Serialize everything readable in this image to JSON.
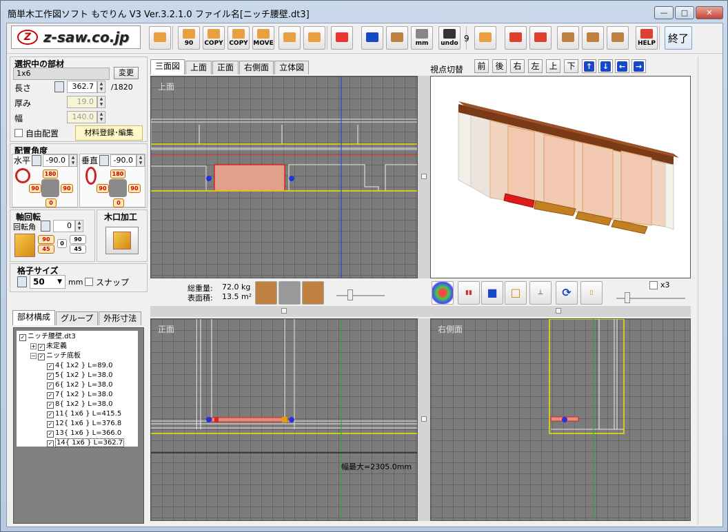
{
  "window": {
    "title": "簡単木工作図ソフト もでりん V3   Ver.3.2.1.0  ファイル名[ニッチ腰壁.dt3]",
    "min": "—",
    "max": "□",
    "close": "✕"
  },
  "toolbar": {
    "logo_text": "z-saw.co.jp",
    "buttons": [
      {
        "name": "add-part",
        "label": ""
      },
      {
        "name": "rotate90",
        "label": "90"
      },
      {
        "name": "copy",
        "label": "COPY"
      },
      {
        "name": "copy-multi",
        "label": "COPY"
      },
      {
        "name": "move",
        "label": "MOVE"
      },
      {
        "name": "mirror",
        "label": ""
      },
      {
        "name": "align",
        "label": ""
      },
      {
        "name": "delete",
        "label": ""
      },
      {
        "name": "frame",
        "label": ""
      },
      {
        "name": "grid-panel",
        "label": ""
      },
      {
        "name": "measure",
        "label": "mm"
      },
      {
        "name": "undo",
        "label": "undo"
      },
      {
        "name": "redo",
        "label": ""
      },
      {
        "name": "import",
        "label": ""
      },
      {
        "name": "export",
        "label": ""
      },
      {
        "name": "page-setup",
        "label": ""
      },
      {
        "name": "house",
        "label": ""
      },
      {
        "name": "table",
        "label": ""
      },
      {
        "name": "help",
        "label": "HELP"
      }
    ],
    "undo_count": "9",
    "exit_label": "終了"
  },
  "selected_part": {
    "title": "選択中の部材",
    "name": "1x6",
    "change_label": "変更",
    "length_label": "長さ",
    "length": "362.7",
    "length_max": "/1820",
    "thickness_label": "厚み",
    "thickness": "19.0",
    "width_label": "幅",
    "width": "140.0",
    "free_place_label": "自由配置",
    "material_btn": "材料登録･編集"
  },
  "angle": {
    "title": "配置角度",
    "horizontal_label": "水平",
    "horizontal": "-90.0",
    "vertical_label": "垂直",
    "vertical": "-90.0",
    "presets": [
      "180",
      "90",
      "90",
      "0"
    ]
  },
  "axis": {
    "title": "軸回転",
    "rot_label": "回転角",
    "rot": "0",
    "btns": [
      "90",
      "45",
      "0",
      "90",
      "45"
    ]
  },
  "woodcut": {
    "title": "木口加工"
  },
  "grid": {
    "title": "格子サイズ",
    "value": "50",
    "unit": "mm",
    "snap_label": "スナップ"
  },
  "tabs_left": [
    "部材構成",
    "グループ",
    "外形寸法"
  ],
  "tree": [
    {
      "indent": 0,
      "text": "ニッチ腰壁.dt3",
      "box": ""
    },
    {
      "indent": 1,
      "text": "未定義",
      "box": "+"
    },
    {
      "indent": 1,
      "text": "ニッチ底板",
      "box": "−"
    },
    {
      "indent": 2,
      "text": "4{ 1x2 } L=89.0"
    },
    {
      "indent": 2,
      "text": "5{ 1x2 } L=38.0"
    },
    {
      "indent": 2,
      "text": "6{ 1x2 } L=38.0"
    },
    {
      "indent": 2,
      "text": "7{ 1x2 } L=38.0"
    },
    {
      "indent": 2,
      "text": "8{ 1x2 } L=38.0"
    },
    {
      "indent": 2,
      "text": "11{ 1x6 } L=415.5"
    },
    {
      "indent": 2,
      "text": "12{ 1x6 } L=376.8"
    },
    {
      "indent": 2,
      "text": "13{ 1x6 } L=366.0"
    },
    {
      "indent": 2,
      "text": "14{ 1x6 } L=362.7"
    }
  ],
  "view_tabs": [
    "三面図",
    "上面",
    "正面",
    "右側面",
    "立体図"
  ],
  "viewpoint": {
    "label": "視点切替",
    "buttons": [
      "前",
      "後",
      "右",
      "左",
      "上",
      "下"
    ],
    "arrows": [
      "↑",
      "↓",
      "←",
      "→"
    ]
  },
  "views": {
    "top": "上面",
    "front": "正面",
    "side": "右側面"
  },
  "stats": {
    "weight_label": "総重量:",
    "weight": "72.0 kg",
    "area_label": "表面積:",
    "area": "13.5 m²"
  },
  "zoom_label": "x3",
  "front_dimension": "幅最大=2305.0mm"
}
